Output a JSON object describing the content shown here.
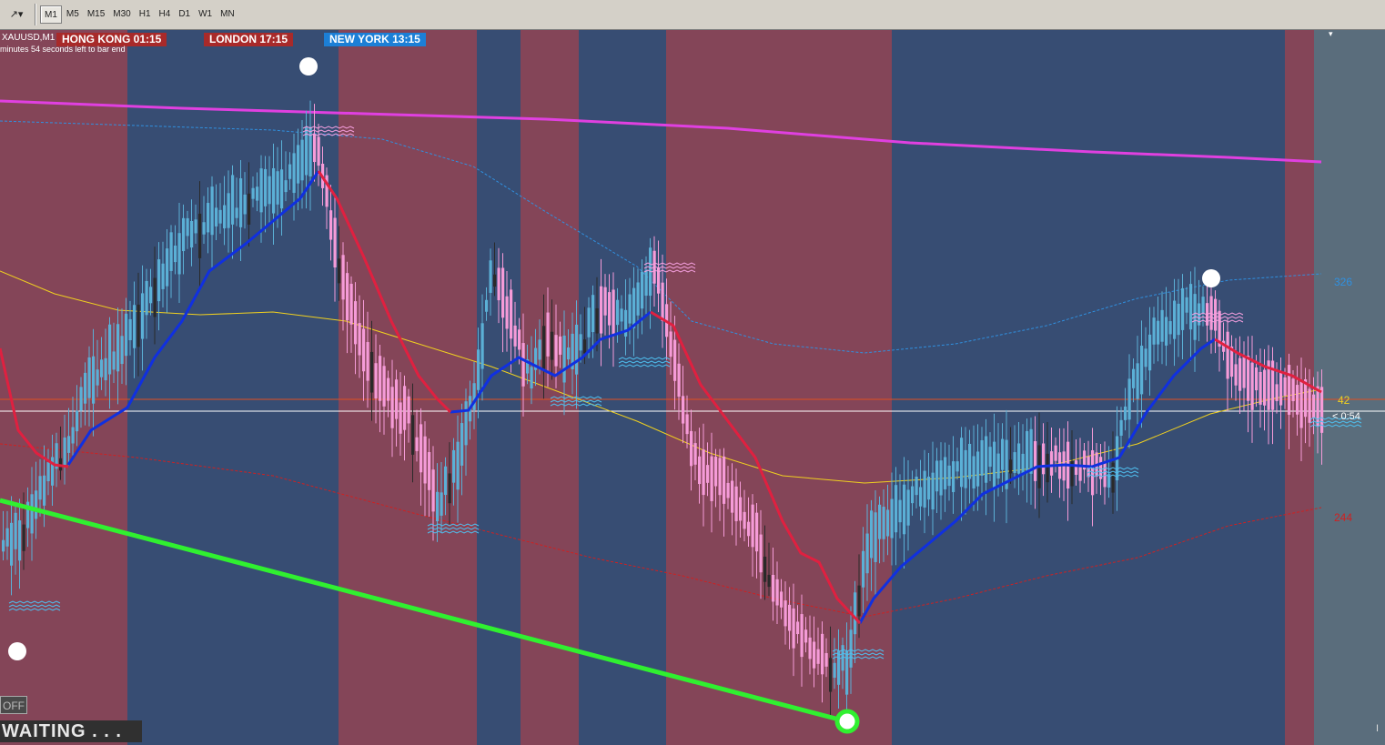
{
  "toolbar": {
    "tool_icon_label": "↗▾",
    "timeframes": [
      "M1",
      "M5",
      "M15",
      "M30",
      "H1",
      "H4",
      "D1",
      "W1",
      "MN"
    ],
    "active_timeframe": "M1"
  },
  "chart": {
    "symbol": "XAUUSD,M1",
    "countdown_text": "minutes 54 seconds left to bar end",
    "sessions": [
      {
        "name": "HONG KONG",
        "time": "01:15",
        "label": "HONG KONG  01:15",
        "color": "#a82a2a"
      },
      {
        "name": "LONDON",
        "time": "17:15",
        "label": "LONDON  17:15",
        "color": "#a82a2a"
      },
      {
        "name": "NEW YORK",
        "time": "13:15",
        "label": "NEW YORK  13:15",
        "color": "#1c7fd6"
      }
    ],
    "off_button": "OFF",
    "status_text": "WAITING . . .",
    "right_labels": {
      "upper": "326",
      "middle": "42",
      "lower": "244",
      "clock": "< 0:54"
    },
    "bottom_right": "I"
  },
  "colors": {
    "red_band": "#844558",
    "blue_band": "#374d73",
    "grey_area": "#5a6d7c",
    "bull_candle": "#5bb0d6",
    "bear_candle": "#f59bd8",
    "dark_candle": "#2a2a2a",
    "magenta_ma": "#e040e0",
    "yellow_ma": "#f0d020",
    "blue_trend": "#1030e0",
    "red_trend": "#e02040",
    "green_line": "#30f030",
    "upper_band": "#3090e0",
    "lower_band": "#d02020",
    "hline_orange": "#e05020",
    "hline_white": "#ffffff"
  },
  "icons": {
    "signal_dot": "white-circle",
    "green_marker": "green-ring-circle"
  }
}
